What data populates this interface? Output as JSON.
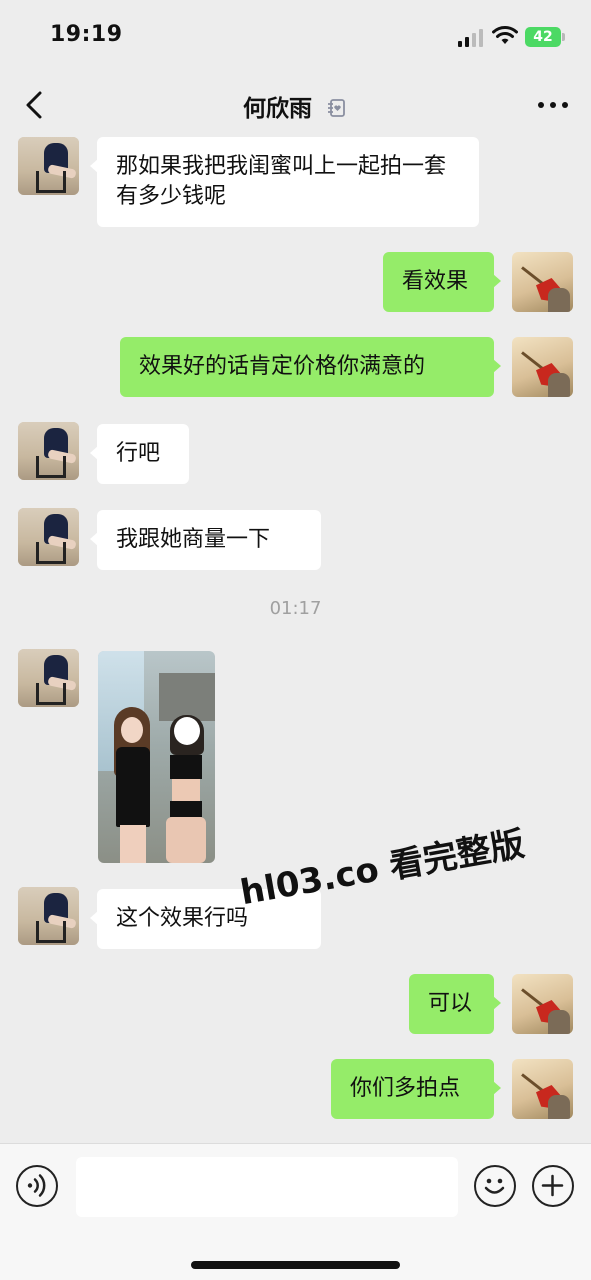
{
  "status_bar": {
    "time": "19:19",
    "battery": "42"
  },
  "header": {
    "title": "何欣雨",
    "back_icon": "chevron-left-icon",
    "more_icon": "more-dots-icon"
  },
  "messages": [
    {
      "side": "in",
      "text": "那如果我把我闺蜜叫上一起拍一套有多少钱呢"
    },
    {
      "side": "out",
      "text": "看效果"
    },
    {
      "side": "out",
      "text": "效果好的话肯定价格你满意的"
    },
    {
      "side": "in",
      "text": "行吧"
    },
    {
      "side": "in",
      "text": "我跟她商量一下"
    },
    {
      "side": "in",
      "type": "image"
    },
    {
      "side": "in",
      "text": "这个效果行吗"
    },
    {
      "side": "out",
      "text": "可以"
    },
    {
      "side": "out",
      "text": "你们多拍点"
    }
  ],
  "timestamp": "01:17",
  "watermark": "hl03.co 看完整版",
  "input_bar": {
    "placeholder": "",
    "icons": [
      "voice-icon",
      "emoji-icon",
      "plus-icon"
    ]
  },
  "colors": {
    "background": "#ededed",
    "incoming_bubble": "#ffffff",
    "outgoing_bubble": "#95ec69",
    "battery": "#4cd964"
  }
}
